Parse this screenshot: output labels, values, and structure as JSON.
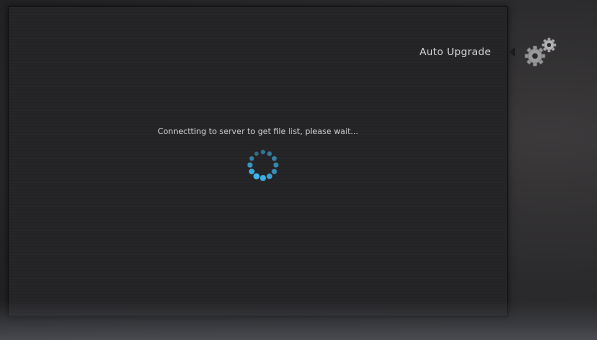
{
  "dialog": {
    "title": "Auto Upgrade",
    "message": "Connectting to server to get file list, please wait...",
    "icon": "gears-icon",
    "spinner_icon": "loading-spinner-icon"
  },
  "colors": {
    "spinner": "#3fb6ec",
    "panel_background": "#232325",
    "text": "#cfcfcf"
  }
}
